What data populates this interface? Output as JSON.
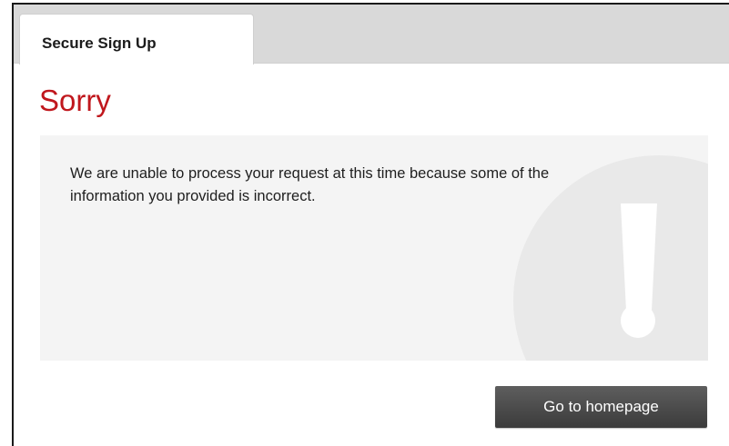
{
  "tabs": {
    "active_label": "Secure Sign Up"
  },
  "page": {
    "title": "Sorry",
    "message": "We are unable to process your request at this time because some of the information you provided is incorrect."
  },
  "actions": {
    "homepage_label": "Go to homepage"
  },
  "icons": {
    "panel_graphic": "exclamation-icon"
  },
  "colors": {
    "title": "#c0171d",
    "button": "#4a4a4a",
    "panel": "#f4f4f4",
    "tabbar": "#d9d9d9"
  }
}
